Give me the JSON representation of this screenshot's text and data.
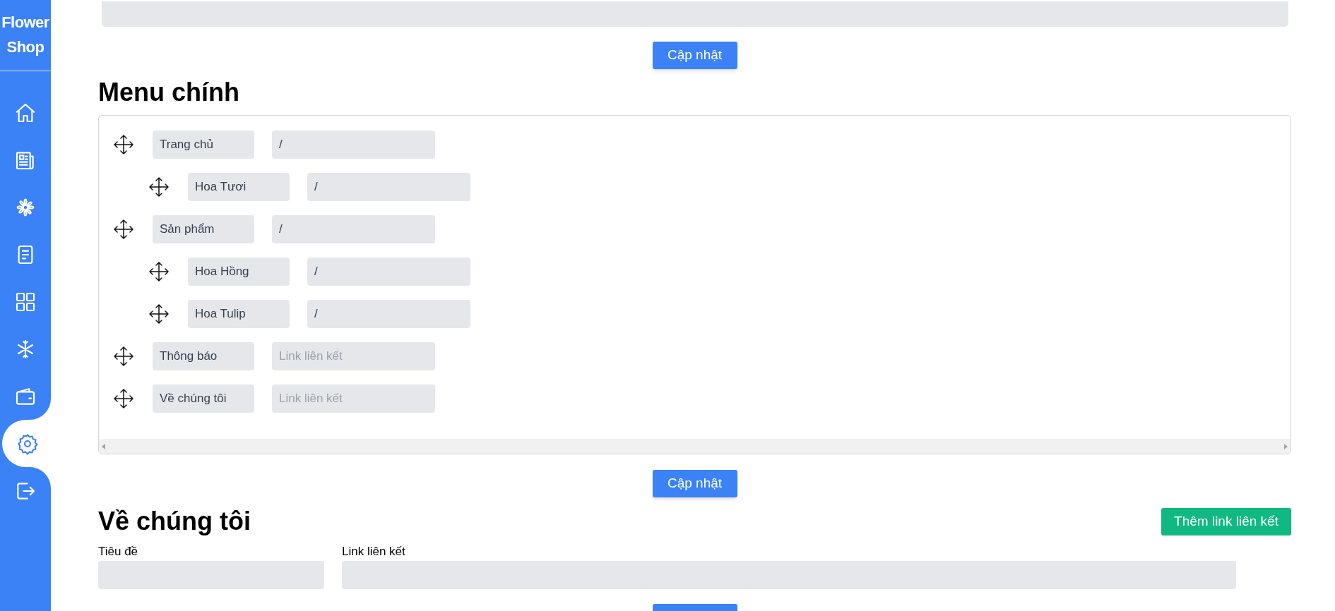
{
  "sidebar": {
    "logo": "Flower Shop",
    "items": [
      {
        "selected": false
      },
      {
        "selected": false
      },
      {
        "selected": false
      },
      {
        "selected": false
      },
      {
        "selected": false
      },
      {
        "selected": false
      },
      {
        "selected": false
      },
      {
        "selected": true
      },
      {
        "selected": false
      }
    ]
  },
  "top_update_button": "Cập nhật",
  "main_menu": {
    "title": "Menu chính",
    "items": [
      {
        "label": "Trang chủ",
        "link": "/",
        "children": [
          {
            "label": "Hoa Tươi",
            "link": "/"
          }
        ]
      },
      {
        "label": "Sản phẩm",
        "link": "/",
        "children": [
          {
            "label": "Hoa Hồng",
            "link": "/"
          },
          {
            "label": "Hoa Tulip",
            "link": "/"
          }
        ]
      },
      {
        "label": "Thông báo",
        "link_placeholder": "Link liên kết"
      },
      {
        "label": "Về chúng tôi",
        "link_placeholder": "Link liên kết"
      }
    ],
    "update_button": "Cập nhật"
  },
  "about": {
    "title": "Về chúng tôi",
    "add_button": "Thêm link liên kết",
    "title_label": "Tiêu đề",
    "link_label": "Link liên kết"
  }
}
